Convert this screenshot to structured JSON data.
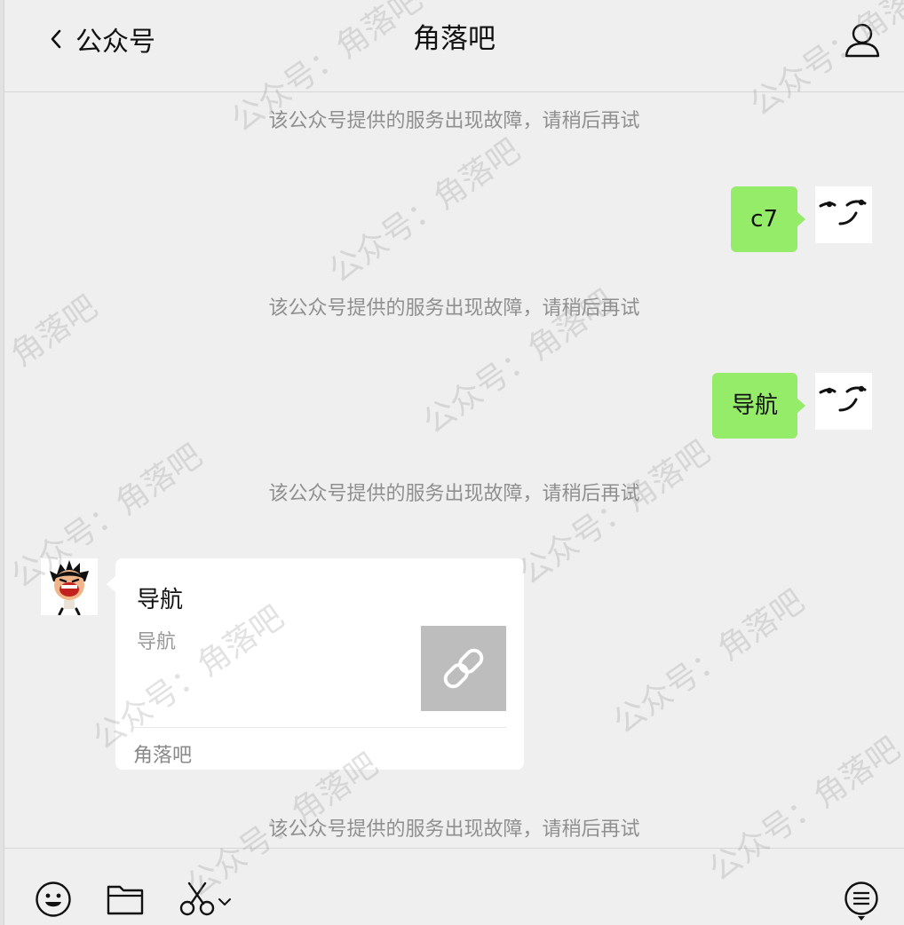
{
  "header": {
    "back_label": "公众号",
    "title": "角落吧"
  },
  "chat": {
    "notices": [
      "该公众号提供的服务出现故障，请稍后再试",
      "该公众号提供的服务出现故障，请稍后再试",
      "该公众号提供的服务出现故障，请稍后再试",
      "该公众号提供的服务出现故障，请稍后再试"
    ],
    "sent_messages": [
      "c7",
      "导航"
    ],
    "card": {
      "title": "导航",
      "description": "导航",
      "source": "角落吧"
    }
  },
  "watermark": {
    "full": "公众号：角落吧",
    "short": "角落吧"
  },
  "colors": {
    "background": "#efefef",
    "sent_bubble": "#94ec68",
    "notice_text": "#8f8f8f"
  },
  "icons": {
    "back": "chevron-left-icon",
    "profile": "person-icon",
    "emoji": "smiley-icon",
    "file": "folder-icon",
    "screenshot": "scissors-icon",
    "history": "chat-list-icon"
  }
}
